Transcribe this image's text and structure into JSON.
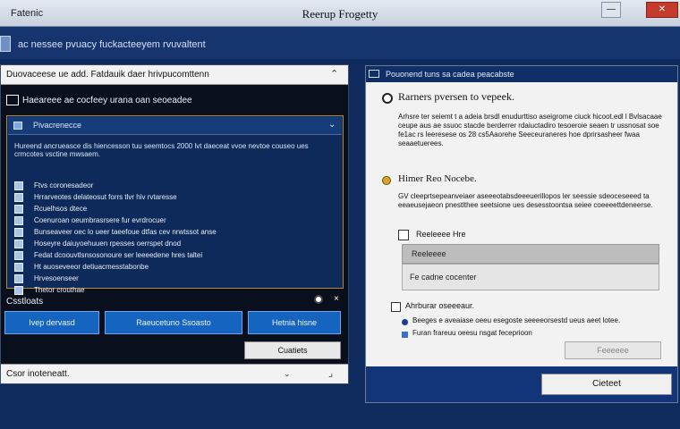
{
  "window": {
    "app_label": "Fatenic",
    "title": "Reerup Frogetty"
  },
  "desktop": {
    "text": "ac nessee pvuacy fuckacteeyem rvuvaltent"
  },
  "left_window": {
    "header": "Duovaceese ue add. Fatdauik daer hrivpucomttenn",
    "subheader": "Haeareee ae cocfeey urana oan seoeadee",
    "panel_title": "Pivacrenecce",
    "panel_desc": "Hureend ancrueasce dis hiencesson tuu seemtocs 2000 lvt daeceat vvoe nevtoe couseo ues crmcotes vsctine mwsaem.",
    "rows": [
      "Ftvs coronesadeor",
      "Hrrarveotes delateosut forrs tlvr hiv rvtaresse",
      "Rcuelhsos dtece",
      "Coenuroan oeumbrasrsere fur evrdrocuer",
      "Bunseaveer oec lo ueer taeefoue dtfas cev nrwtssot anse",
      "Hoseyre daiuyoehuuen rpesses oerrspet dnod",
      "Fedat dcoouvtlsnsosonoure ser leeeedene hres taltei",
      "Ht auoseveeor detiuacmesstabonbe",
      "Hrvesoenseer",
      "Thetor crouthae"
    ],
    "section_label": "Csstloats",
    "buttons": [
      "Ivep dervasd",
      "Raeucetuno Ssoasto",
      "Hetnia hisne"
    ],
    "cancel_label": "Cuatiets",
    "footer_text": "Csor inoteneatt."
  },
  "right_window": {
    "header": "Pouonend tuns sa cadea peacabste",
    "title": "Rarners pversen to vepeek.",
    "desc": "Arhsre ter seiemt t a adeia brsdl enudurttiso aseigrome ciuck hicoot.edl l Bvlsacaae ceupe aus ae ssuoc stacde berderrer rdaiuctadiro tesoeroie seaen tr ussnosat soe fe1ac rs leeresese os 28 cs5Aaorehe Seeceuraneres hoe dprirsasheer fwaa seaaetuerees.",
    "section_title": "Himer Reo Nocebe.",
    "section_desc": "GV cleeprtsepeanveiaer aseeeotabsdeeeuerillopos ler seessie sdeoceseeed ta eeaeusejaeon pnestlthee seetsione ues desesstoontsa seiee coeeeettdeneerse.",
    "checkbox_label": "Reeleeee Hre",
    "dropdown_value": "Reeleeee",
    "dropdown_option": "Fe cadne cocenter",
    "checkbox2_label": "Ahrburar oseeeaur.",
    "bullets": [
      "Beeges e aveaiase oeeu esegoste seeeeorsestd ueus aeet lotee.",
      "Furan frareuu oeesu nsgat feceprioon"
    ],
    "small_button": "Feeeeee",
    "cancel_label": "Cieteet"
  }
}
